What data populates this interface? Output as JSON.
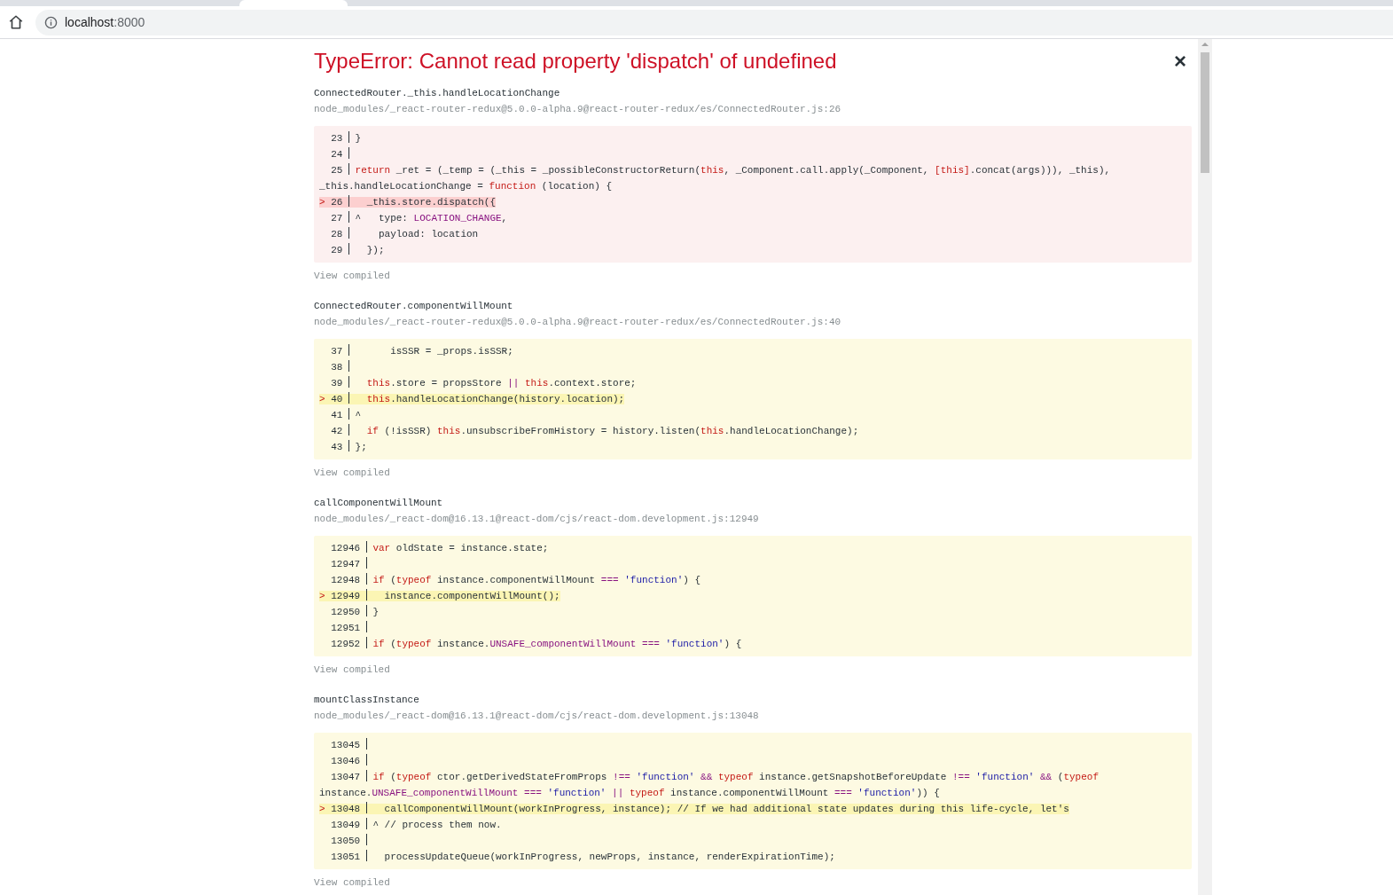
{
  "browser": {
    "url_host": "localhost",
    "url_port": ":8000"
  },
  "overlay": {
    "title": "TypeError: Cannot read property 'dispatch' of undefined",
    "close": "×"
  },
  "frames": [
    {
      "function": "ConnectedRouter._this.handleLocationChange",
      "file": "node_modules/_react-router-redux@5.0.0-alpha.9@react-router-redux/es/ConnectedRouter.js:26",
      "kind": "error",
      "link": "View compiled",
      "lines": [
        {
          "number": "23",
          "highlighted": false,
          "code": [
            {
              "kind": "plain",
              "text": "}"
            }
          ]
        },
        {
          "number": "24",
          "highlighted": false
        },
        {
          "number": "25",
          "highlighted": false,
          "code": [
            {
              "kind": "keyword",
              "text": "return"
            },
            {
              "kind": "plain",
              "text": " _ret = (_temp = (_this = _possibleConstructorReturn("
            },
            {
              "kind": "keyword",
              "text": "this"
            },
            {
              "kind": "plain",
              "text": ", _Component.call.apply(_Component, "
            },
            {
              "kind": "keyword",
              "text": "[this]"
            },
            {
              "kind": "plain",
              "text": ".concat(args))), _this), _this.handleLocationChange = "
            },
            {
              "kind": "keyword",
              "text": "function"
            },
            {
              "kind": "plain",
              "text": " (location) {"
            }
          ]
        },
        {
          "number": "26",
          "highlighted": true,
          "marker": ">",
          "code": [
            {
              "kind": "plain",
              "text": "  _this.store.dispatch({"
            }
          ]
        },
        {
          "number": "27",
          "highlighted": false,
          "code": [
            {
              "kind": "plain",
              "text": "^   type: "
            },
            {
              "kind": "constant",
              "text": "LOCATION_CHANGE"
            },
            {
              "kind": "plain",
              "text": ","
            }
          ]
        },
        {
          "number": "28",
          "highlighted": false,
          "code": [
            {
              "kind": "plain",
              "text": "    payload: location"
            }
          ]
        },
        {
          "number": "29",
          "highlighted": false,
          "code": [
            {
              "kind": "plain",
              "text": "  });"
            }
          ]
        }
      ]
    },
    {
      "function": "ConnectedRouter.componentWillMount",
      "file": "node_modules/_react-router-redux@5.0.0-alpha.9@react-router-redux/es/ConnectedRouter.js:40",
      "kind": "context",
      "link": "View compiled",
      "lines": [
        {
          "number": "37",
          "highlighted": false,
          "code": [
            {
              "kind": "plain",
              "text": "      isSSR = _props.isSSR;"
            }
          ]
        },
        {
          "number": "38",
          "highlighted": false
        },
        {
          "number": "39",
          "highlighted": false,
          "code": [
            {
              "kind": "keyword",
              "text": "  this"
            },
            {
              "kind": "plain",
              "text": ".store = propsStore "
            },
            {
              "kind": "constant",
              "text": "||"
            },
            {
              "kind": "keyword",
              "text": " this"
            },
            {
              "kind": "plain",
              "text": ".context.store;"
            }
          ]
        },
        {
          "number": "40",
          "highlighted": true,
          "marker": ">",
          "code": [
            {
              "kind": "keyword",
              "text": "  this"
            },
            {
              "kind": "plain",
              "text": ".handleLocationChange(history.location);"
            }
          ]
        },
        {
          "number": "41",
          "highlighted": false,
          "code": [
            {
              "kind": "plain",
              "text": "^"
            }
          ]
        },
        {
          "number": "42",
          "highlighted": false,
          "code": [
            {
              "kind": "keyword",
              "text": "  if"
            },
            {
              "kind": "plain",
              "text": " (!isSSR) "
            },
            {
              "kind": "keyword",
              "text": "this"
            },
            {
              "kind": "plain",
              "text": ".unsubscribeFromHistory = history.listen("
            },
            {
              "kind": "keyword",
              "text": "this"
            },
            {
              "kind": "plain",
              "text": ".handleLocationChange);"
            }
          ]
        },
        {
          "number": "43",
          "highlighted": false,
          "code": [
            {
              "kind": "plain",
              "text": "};"
            }
          ]
        }
      ]
    },
    {
      "function": "callComponentWillMount",
      "file": "node_modules/_react-dom@16.13.1@react-dom/cjs/react-dom.development.js:12949",
      "kind": "context",
      "link": "View compiled",
      "lines": [
        {
          "number": "12946",
          "highlighted": false,
          "code": [
            {
              "kind": "keyword",
              "text": "var"
            },
            {
              "kind": "plain",
              "text": " oldState = instance.state;"
            }
          ]
        },
        {
          "number": "12947",
          "highlighted": false
        },
        {
          "number": "12948",
          "highlighted": false,
          "code": [
            {
              "kind": "keyword",
              "text": "if"
            },
            {
              "kind": "plain",
              "text": " ("
            },
            {
              "kind": "keyword",
              "text": "typeof"
            },
            {
              "kind": "plain",
              "text": " instance.componentWillMount "
            },
            {
              "kind": "constant",
              "text": "==="
            },
            {
              "kind": "string",
              "text": " 'function'"
            },
            {
              "kind": "plain",
              "text": ") {"
            }
          ]
        },
        {
          "number": "12949",
          "highlighted": true,
          "marker": ">",
          "code": [
            {
              "kind": "plain",
              "text": "  instance.componentWillMount();"
            }
          ]
        },
        {
          "number": "12950",
          "highlighted": false,
          "code": [
            {
              "kind": "plain",
              "text": "}"
            }
          ]
        },
        {
          "number": "12951",
          "highlighted": false
        },
        {
          "number": "12952",
          "highlighted": false,
          "code": [
            {
              "kind": "keyword",
              "text": "if"
            },
            {
              "kind": "plain",
              "text": " ("
            },
            {
              "kind": "keyword",
              "text": "typeof"
            },
            {
              "kind": "plain",
              "text": " instance."
            },
            {
              "kind": "constant",
              "text": "UNSAFE_componentWillMount ==="
            },
            {
              "kind": "string",
              "text": " 'function'"
            },
            {
              "kind": "plain",
              "text": ") {"
            }
          ]
        }
      ]
    },
    {
      "function": "mountClassInstance",
      "file": "node_modules/_react-dom@16.13.1@react-dom/cjs/react-dom.development.js:13048",
      "kind": "context",
      "link": "View compiled",
      "lines": [
        {
          "number": "13045",
          "highlighted": false
        },
        {
          "number": "13046",
          "highlighted": false
        },
        {
          "number": "13047",
          "highlighted": false,
          "code": [
            {
              "kind": "keyword",
              "text": "if"
            },
            {
              "kind": "plain",
              "text": " ("
            },
            {
              "kind": "keyword",
              "text": "typeof"
            },
            {
              "kind": "plain",
              "text": " ctor.getDerivedStateFromProps "
            },
            {
              "kind": "constant",
              "text": "!=="
            },
            {
              "kind": "string",
              "text": " 'function'"
            },
            {
              "kind": "constant",
              "text": " &&"
            },
            {
              "kind": "keyword",
              "text": " typeof"
            },
            {
              "kind": "plain",
              "text": " instance.getSnapshotBeforeUpdate "
            },
            {
              "kind": "constant",
              "text": "!=="
            },
            {
              "kind": "string",
              "text": " 'function'"
            },
            {
              "kind": "constant",
              "text": " &&"
            },
            {
              "kind": "plain",
              "text": " ("
            },
            {
              "kind": "keyword",
              "text": "typeof"
            },
            {
              "kind": "plain",
              "text": " instance."
            },
            {
              "kind": "constant",
              "text": "UNSAFE_componentWillMount ==="
            },
            {
              "kind": "string",
              "text": " 'function'"
            },
            {
              "kind": "constant",
              "text": " ||"
            },
            {
              "kind": "keyword",
              "text": " typeof"
            },
            {
              "kind": "plain",
              "text": " instance.componentWillMount "
            },
            {
              "kind": "constant",
              "text": "==="
            },
            {
              "kind": "string",
              "text": " 'function'"
            },
            {
              "kind": "plain",
              "text": ")) {"
            }
          ]
        },
        {
          "number": "13048",
          "highlighted": true,
          "marker": ">",
          "code": [
            {
              "kind": "plain",
              "text": "  callComponentWillMount(workInProgress, instance); // If we had additional state updates during this life-cycle, let's"
            }
          ]
        },
        {
          "number": "13049",
          "highlighted": false,
          "code": [
            {
              "kind": "plain",
              "text": "^ // process them now."
            }
          ]
        },
        {
          "number": "13050",
          "highlighted": false
        },
        {
          "number": "13051",
          "highlighted": false,
          "code": [
            {
              "kind": "plain",
              "text": "  processUpdateQueue(workInProgress, newProps, instance, renderExpirationTime);"
            }
          ]
        }
      ]
    }
  ]
}
